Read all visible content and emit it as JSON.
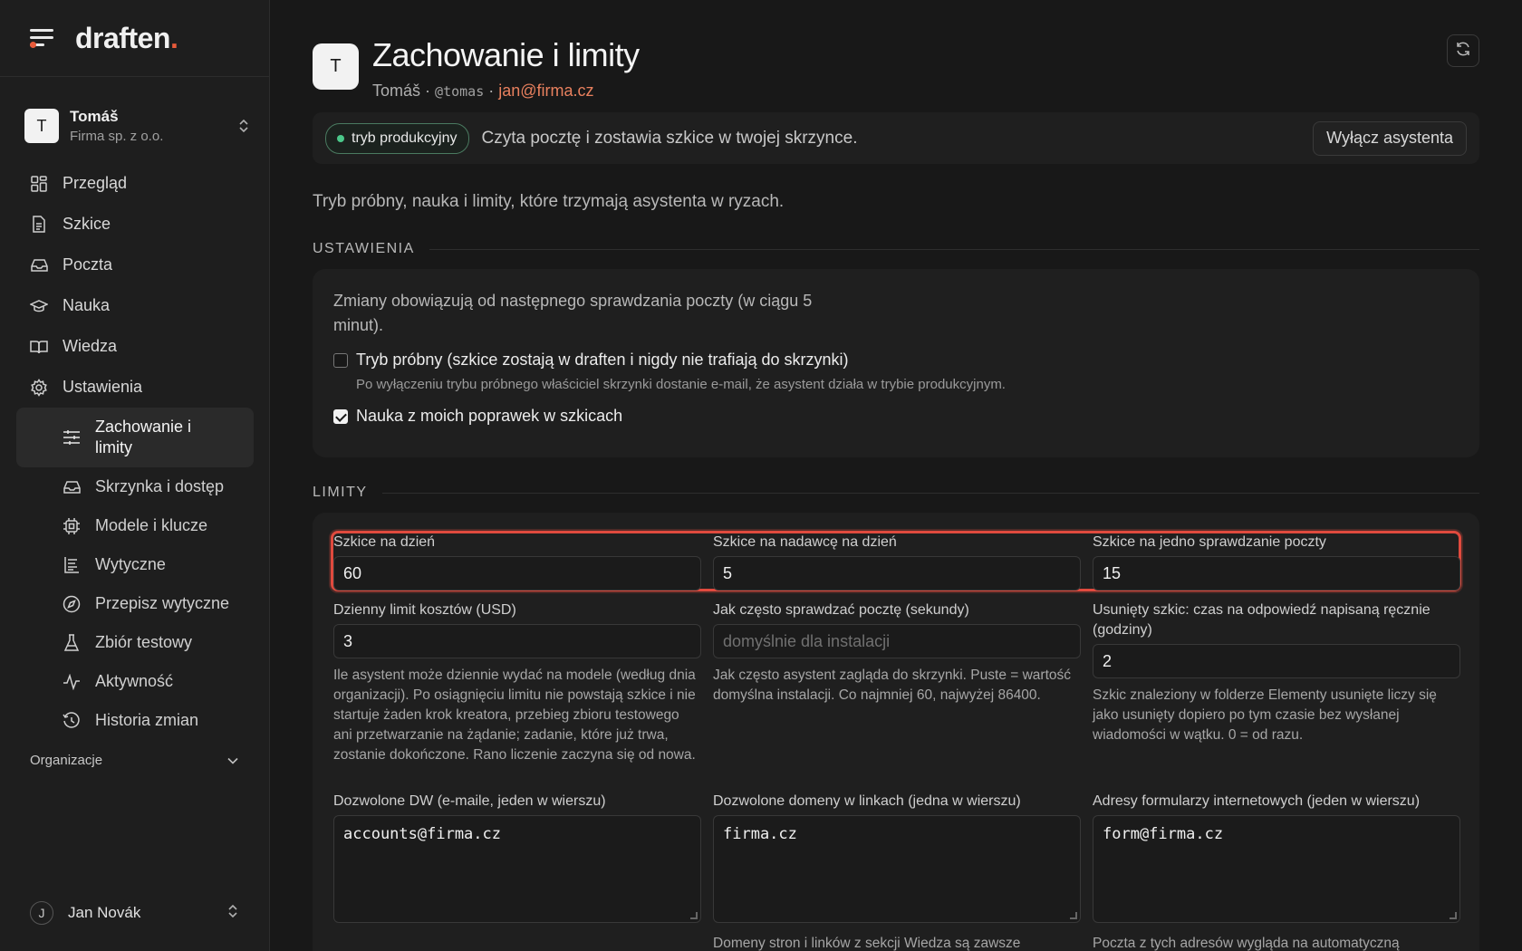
{
  "brand": {
    "logo": "draften",
    "logo_dot": "."
  },
  "account": {
    "initial": "T",
    "name": "Tomáš",
    "org": "Firma sp. z o.o."
  },
  "nav": [
    {
      "label": "Przegląd",
      "icon": "grid-icon"
    },
    {
      "label": "Szkice",
      "icon": "document-icon"
    },
    {
      "label": "Poczta",
      "icon": "inbox-icon"
    },
    {
      "label": "Nauka",
      "icon": "graduation-cap-icon"
    },
    {
      "label": "Wiedza",
      "icon": "book-icon"
    },
    {
      "label": "Ustawienia",
      "icon": "gear-icon"
    }
  ],
  "subnav": [
    {
      "label": "Zachowanie i limity",
      "icon": "sliders-icon",
      "active": true
    },
    {
      "label": "Skrzynka i dostęp",
      "icon": "inbox-icon"
    },
    {
      "label": "Modele i klucze",
      "icon": "chip-icon"
    },
    {
      "label": "Wytyczne",
      "icon": "guidelines-icon"
    },
    {
      "label": "Przepisz wytyczne",
      "icon": "compass-icon"
    },
    {
      "label": "Zbiór testowy",
      "icon": "flask-icon"
    },
    {
      "label": "Aktywność",
      "icon": "activity-icon"
    },
    {
      "label": "Historia zmian",
      "icon": "history-icon"
    }
  ],
  "orgs_label": "Organizacje",
  "user": {
    "initial": "J",
    "name": "Jan Novák"
  },
  "header": {
    "initial": "T",
    "title": "Zachowanie i limity",
    "name": "Tomáš",
    "sep": "·",
    "handle": "@tomas",
    "email": "jan@firma.cz"
  },
  "banner": {
    "badge": "tryb produkcyjny",
    "text": "Czyta pocztę i zostawia szkice w twojej skrzynce.",
    "button": "Wyłącz asystenta",
    "badge_color": "#4bc88a"
  },
  "intro": "Tryb próbny, nauka i limity, które trzymają asystenta w ryzach.",
  "settings": {
    "heading": "USTAWIENIA",
    "note": "Zmiany obowiązują od następnego sprawdzania poczty (w ciągu 5 minut).",
    "trial_label": "Tryb próbny (szkice zostają w draften i nigdy nie trafiają do skrzynki)",
    "trial_help": "Po wyłączeniu trybu próbnego właściciel skrzynki dostanie e-mail, że asystent działa w trybie produkcyjnym.",
    "trial_checked": false,
    "learn_label": "Nauka z moich poprawek w szkicach",
    "learn_checked": true
  },
  "limits": {
    "heading": "LIMITY",
    "per_day": {
      "label": "Szkice na dzień",
      "value": "60"
    },
    "per_sender": {
      "label": "Szkice na nadawcę na dzień",
      "value": "5"
    },
    "per_check": {
      "label": "Szkice na jedno sprawdzanie poczty",
      "value": "15"
    },
    "cost": {
      "label": "Dzienny limit kosztów (USD)",
      "value": "3",
      "help": "Ile asystent może dziennie wydać na modele (według dnia organizacji). Po osiągnięciu limitu nie powstają szkice i nie startuje żaden krok kreatora, przebieg zbioru testowego ani przetwarzanie na żądanie; zadanie, które już trwa, zostanie dokończone. Rano liczenie zaczyna się od nowa."
    },
    "interval": {
      "label": "Jak często sprawdzać pocztę (sekundy)",
      "placeholder": "domyślnie dla instalacji",
      "help": "Jak często asystent zagląda do skrzynki. Puste = wartość domyślna instalacji. Co najmniej 60, najwyżej 86400."
    },
    "deleted": {
      "label": "Usunięty szkic: czas na odpowiedź napisaną ręcznie (godziny)",
      "value": "2",
      "help": "Szkic znaleziony w folderze Elementy usunięte liczy się jako usunięty dopiero po tym czasie bez wysłanej wiadomości w wątku. 0 = od razu."
    },
    "cc": {
      "label": "Dozwolone DW (e-maile, jeden w wierszu)",
      "value": "accounts@firma.cz"
    },
    "domains": {
      "label": "Dozwolone domeny w linkach (jedna w wierszu)",
      "value": "firma.cz",
      "help": "Domeny stron i linków z sekcji Wiedza są zawsze"
    },
    "forms": {
      "label": "Adresy formularzy internetowych (jeden w wierszu)",
      "value": "form@firma.cz",
      "help": "Poczta z tych adresów wygląda na automatyczną"
    }
  },
  "colors": {
    "accent": "#e85a3a",
    "highlight": "#e04a3e",
    "email": "#e8805e"
  }
}
